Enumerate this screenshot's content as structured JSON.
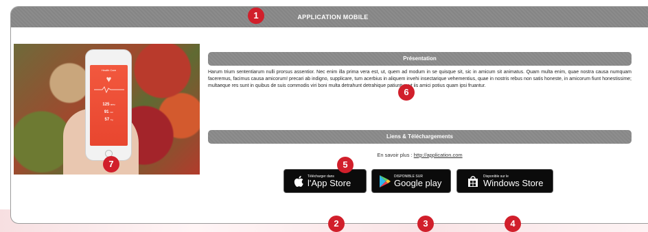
{
  "header": {
    "title": "APPLICATION MOBILE"
  },
  "photo": {
    "phone_screen_title": "Health Care",
    "metrics": [
      {
        "value": "125",
        "unit": "BPM"
      },
      {
        "value": "91",
        "unit": "mm"
      },
      {
        "value": "57",
        "unit": "Kg"
      }
    ]
  },
  "sections": {
    "presentation": "Présentation",
    "links": "Liens & Téléchargements"
  },
  "presentation_text": "Harum trium sententiarum nulli prorsus assentior. Nec enim illa prima vera est, ut, quem ad modum in se quisque sit, sic in amicum sit animatus. Quam multa enim, quae nostra causa numquam faceremus, facimus causa amicorum! precari ab indigno, supplicare, tum acerbius in aliquem invehi insectarique vehementius, quae in nostris rebus non satis honeste, in amicorum fiunt honestissime; multaeque res sunt in quibus de suis commodis viri boni multa detrahunt detrahique patiuntur, ut iis amici potius quam ipsi fruantur.",
  "more": {
    "label": "En savoir plus :",
    "link": "http://application.com"
  },
  "stores": {
    "apple": {
      "small": "Télécharger dans",
      "big": "l'App Store",
      "icon": "apple-icon"
    },
    "google": {
      "small": "DISPONIBLE SUR",
      "big": "Google play",
      "icon": "google-play-icon"
    },
    "windows": {
      "small": "Disponible sur le",
      "big": "Windows Store",
      "icon": "windows-icon"
    }
  },
  "markers": [
    "1",
    "2",
    "3",
    "4",
    "5",
    "6",
    "7"
  ],
  "colors": {
    "marker": "#d11f2b",
    "bar": "#8c8c8c",
    "store_bg": "#0b0b0b"
  }
}
